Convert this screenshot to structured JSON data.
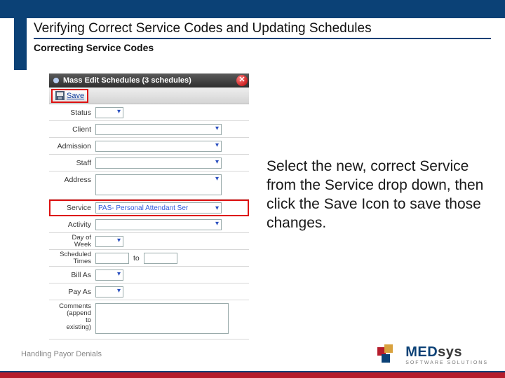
{
  "header": {
    "title": "Verifying Correct Service Codes and Updating Schedules",
    "subtitle": "Correcting Service Codes"
  },
  "dialog": {
    "title": "Mass Edit Schedules (3 schedules)",
    "close": "✕",
    "save_label": "Save",
    "fields": {
      "status": "Status",
      "client": "Client",
      "admission": "Admission",
      "staff": "Staff",
      "address": "Address",
      "service": "Service",
      "service_value": "PAS- Personal Attendant Ser",
      "activity": "Activity",
      "day_of_week": "Day of\nWeek",
      "scheduled_times": "Scheduled\nTimes",
      "to": "to",
      "bill_as": "Bill As",
      "pay_as": "Pay As",
      "comments": "Comments\n(append\nto\nexisting)"
    }
  },
  "instruction": "Select the new, correct Service from the Service drop down, then click the Save Icon to save those changes.",
  "footer": {
    "text": "Handling Payor Denials",
    "logo_main_a": "MED",
    "logo_main_b": "sys",
    "logo_sub": "SOFTWARE SOLUTIONS"
  }
}
